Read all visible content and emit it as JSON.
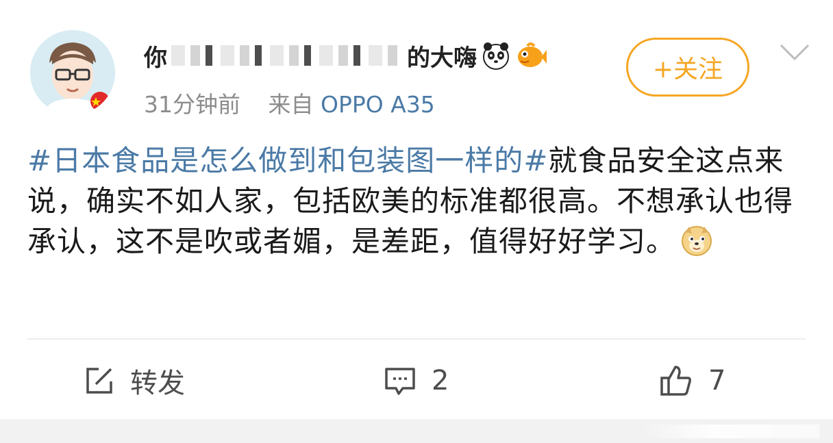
{
  "post": {
    "username_visible_start": "你",
    "username_visible_end": "的大嗨",
    "timestamp": "31分钟前",
    "source_prefix": "来自",
    "source_device": "OPPO A35",
    "follow_label": "+关注",
    "topic": "#日本食品是怎么做到和包装图一样的#",
    "text": "就食品安全这点来说，确实不如人家，包括欧美的标准都很高。不想承认也得承认，这不是吹或者媚，是差距，值得好好学习。"
  },
  "actions": {
    "repost_label": "转发",
    "comment_count": "2",
    "like_count": "7"
  },
  "icons": {
    "repost": "share-icon",
    "comment": "comment-icon",
    "like": "thumbs-up-icon",
    "more": "chevron-down-icon",
    "badge_panda": "panda-badge-icon",
    "badge_fish": "fish-badge-icon",
    "doge": "doge-emoji-icon"
  },
  "colors": {
    "accent": "#f5a623",
    "link": "#4b7aa6",
    "meta": "#8c8c8c"
  }
}
